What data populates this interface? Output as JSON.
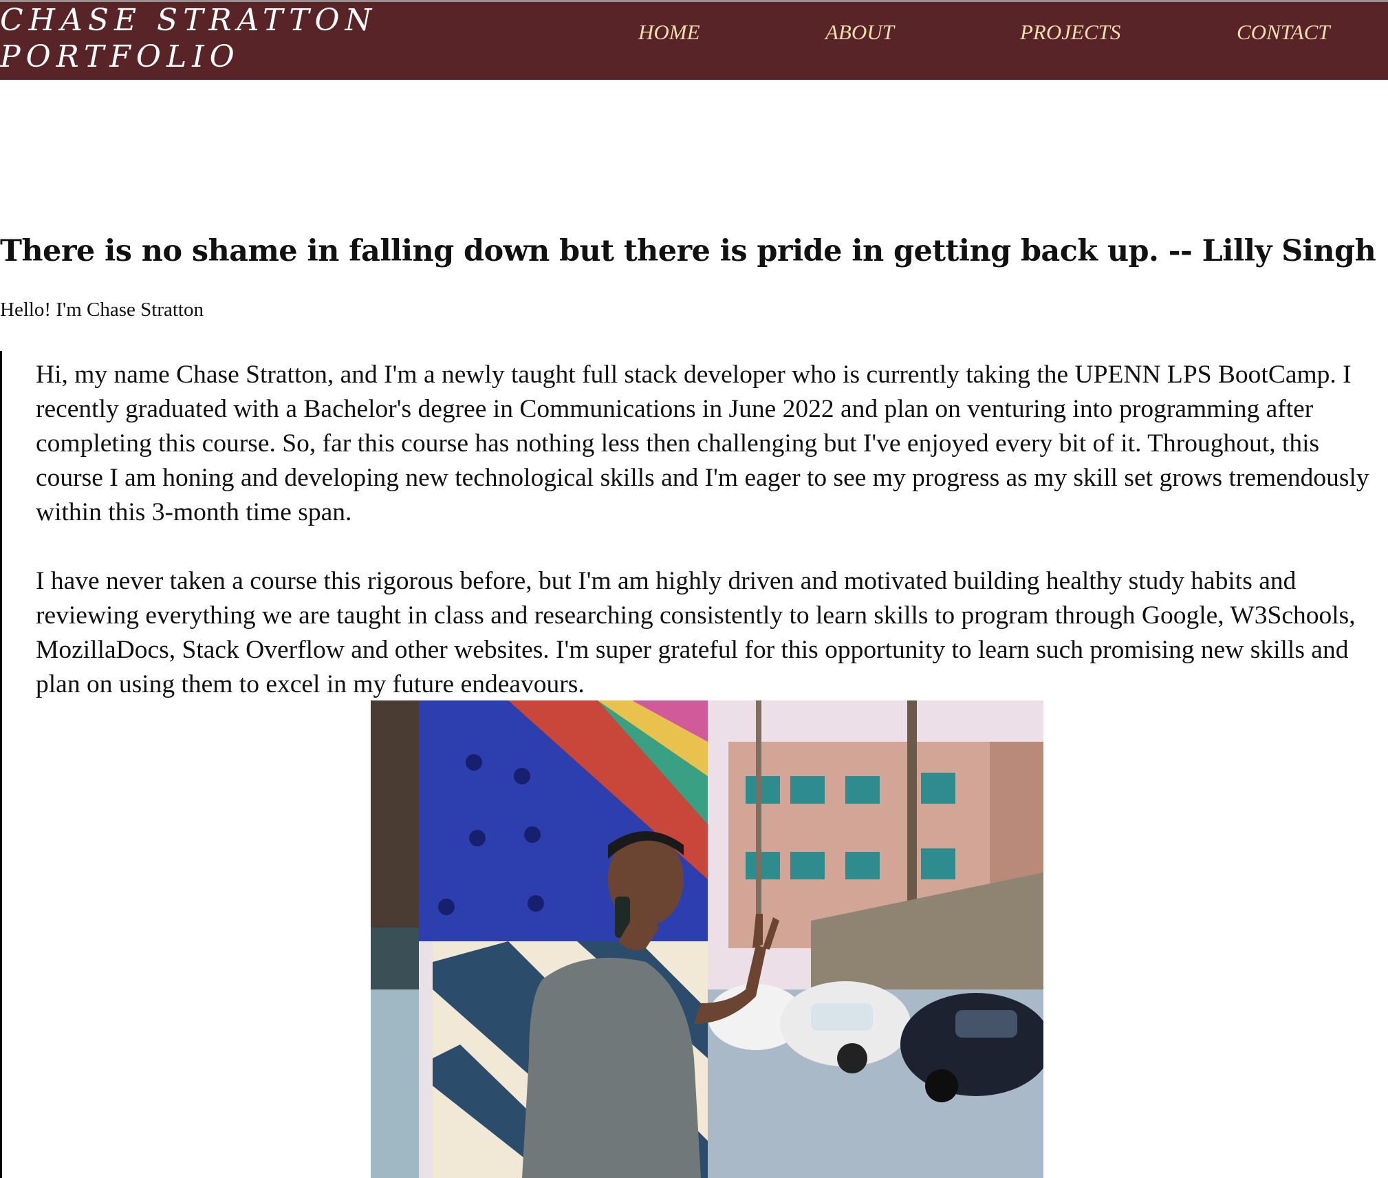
{
  "header": {
    "brand_line1": "CHASE STRATTON",
    "brand_line2": "PORTFOLIO",
    "nav": [
      {
        "label": "HOME"
      },
      {
        "label": "ABOUT"
      },
      {
        "label": "PROJECTS"
      },
      {
        "label": "CONTACT"
      }
    ]
  },
  "main": {
    "quote": "There is no shame in falling down but there is pride in getting back up. -- Lilly Singh",
    "greeting": "Hello! I'm Chase Stratton",
    "paragraphs": [
      "Hi, my name Chase Stratton, and I'm a newly taught full stack developer who is currently taking the UPENN LPS BootCamp. I recently graduated with a Bachelor's degree in Communications in June 2022 and plan on venturing into programming after completing this course. So, far this course has nothing less then challenging but I've enjoyed every bit of it. Throughout, this course I am honing and developing new technological skills and I'm eager to see my progress as my skill set grows tremendously within this 3-month time span.",
      "I have never taken a course this rigorous before, but I'm am highly driven and motivated building healthy study habits and reviewing everything we are taught in class and researching consistently to learn skills to program through Google, W3Schools, MozillaDocs, Stack Overflow and other websites. I'm super grateful for this opportunity to learn such promising new skills and plan on using them to excel in my future endeavours."
    ]
  },
  "colors": {
    "header_bg": "#582428",
    "nav_text": "#f2deaf",
    "brand_text": "#ffffff"
  }
}
